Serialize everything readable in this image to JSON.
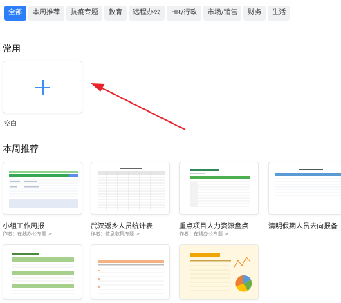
{
  "tabs": [
    {
      "label": "全部",
      "active": true
    },
    {
      "label": "本周推荐"
    },
    {
      "label": "抗疫专题"
    },
    {
      "label": "教育"
    },
    {
      "label": "远程办公"
    },
    {
      "label": "HR/行政"
    },
    {
      "label": "市场/销售"
    },
    {
      "label": "财务"
    },
    {
      "label": "生活"
    }
  ],
  "common": {
    "title": "常用",
    "blank_label": "空白"
  },
  "weekly": {
    "title": "本周推荐",
    "cards": [
      {
        "title": "小组工作周报",
        "author": "作者：在线办公专题 >"
      },
      {
        "title": "武汉返乡人员统计表",
        "author": "作者：信息收集专题 >"
      },
      {
        "title": "重点项目人力资源盘点",
        "author": "作者：在线办公专题 >"
      },
      {
        "title": "清明假期人员去向报备",
        "author": ""
      }
    ]
  },
  "colors": {
    "accent": "#2d7ff9",
    "arrow": "#e8252a"
  }
}
